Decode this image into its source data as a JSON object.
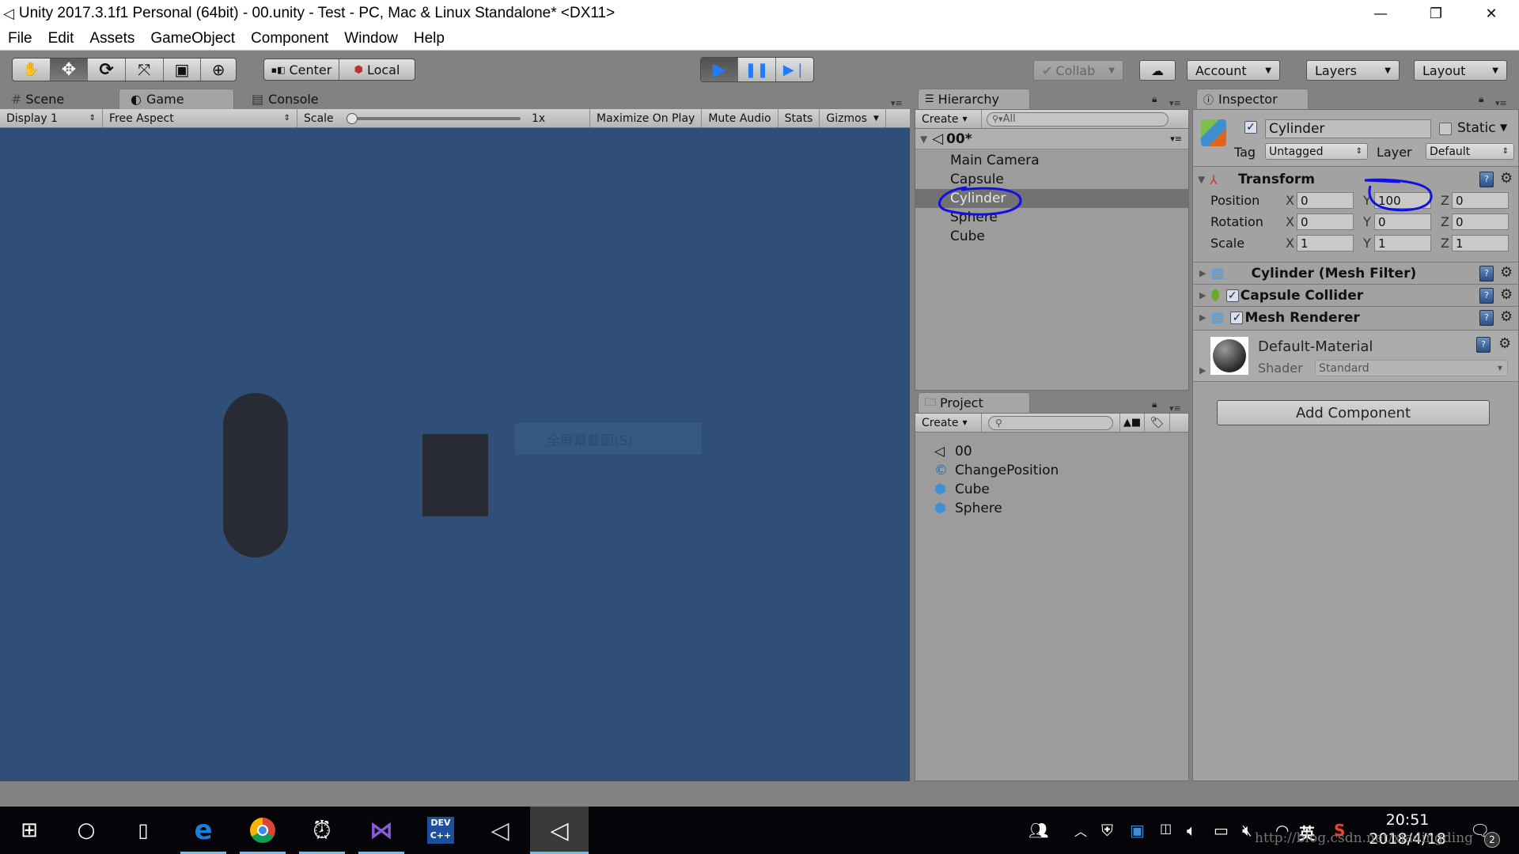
{
  "window": {
    "title": "Unity 2017.3.1f1 Personal (64bit) - 00.unity - Test - PC, Mac & Linux Standalone* <DX11>",
    "controls": {
      "minimize": "—",
      "restore": "❐",
      "close": "✕"
    }
  },
  "menu": [
    "File",
    "Edit",
    "Assets",
    "GameObject",
    "Component",
    "Window",
    "Help"
  ],
  "toolbar": {
    "tools": [
      {
        "name": "hand-tool",
        "glyph": "✋",
        "active": false
      },
      {
        "name": "move-tool",
        "glyph": "✥",
        "active": true
      },
      {
        "name": "rotate-tool",
        "glyph": "⟳",
        "active": false
      },
      {
        "name": "scale-tool",
        "glyph": "⤧",
        "active": false
      },
      {
        "name": "rect-tool",
        "glyph": "▣",
        "active": false
      },
      {
        "name": "transform-tool",
        "glyph": "⊕",
        "active": false
      }
    ],
    "pivot_mode": "Center",
    "pivot_rotation": "Local",
    "play": {
      "play_glyph": "▶",
      "pause_glyph": "❚❚",
      "step_glyph": "▶❘",
      "playing": true,
      "accent": "#1e7cff"
    },
    "collab": "Collab",
    "cloud_glyph": "☁",
    "account": "Account",
    "layers": "Layers",
    "layout": "Layout"
  },
  "game_panel": {
    "tabs": [
      {
        "label": "Scene",
        "glyph": "#",
        "active": false
      },
      {
        "label": "Game",
        "glyph": "◐",
        "active": true
      },
      {
        "label": "Console",
        "glyph": "▤",
        "active": false
      }
    ],
    "display": "Display 1",
    "aspect": "Free Aspect",
    "scale_label": "Scale",
    "scale_value": "1x",
    "scale_fraction": 0.0,
    "maximize_on_play": "Maximize On Play",
    "mute_audio": "Mute Audio",
    "stats": "Stats",
    "gizmos": "Gizmos",
    "background_color": "#2f4e78",
    "object_color": "#282b33",
    "overlay_tooltip": "全屏幕截图(S)"
  },
  "hierarchy": {
    "tab_label": "Hierarchy",
    "create_label": "Create",
    "search_placeholder": "All",
    "scene_name": "00*",
    "items": [
      {
        "label": "Main Camera",
        "selected": false
      },
      {
        "label": "Capsule",
        "selected": false
      },
      {
        "label": "Cylinder",
        "selected": true
      },
      {
        "label": "Sphere",
        "selected": false
      },
      {
        "label": "Cube",
        "selected": false
      }
    ]
  },
  "project": {
    "tab_label": "Project",
    "create_label": "Create",
    "search_placeholder": "",
    "items": [
      {
        "label": "00",
        "icon": "unity-scene-icon"
      },
      {
        "label": "ChangePosition",
        "icon": "csharp-script-icon"
      },
      {
        "label": "Cube",
        "icon": "prefab-icon"
      },
      {
        "label": "Sphere",
        "icon": "prefab-icon"
      }
    ]
  },
  "inspector": {
    "tab_label": "Inspector",
    "object_name": "Cylinder",
    "active": true,
    "static_label": "Static",
    "static": false,
    "tag_label": "Tag",
    "tag_value": "Untagged",
    "layer_label": "Layer",
    "layer_value": "Default",
    "transform": {
      "title": "Transform",
      "rows": [
        {
          "label": "Position",
          "x": "0",
          "y": "100",
          "z": "0"
        },
        {
          "label": "Rotation",
          "x": "0",
          "y": "0",
          "z": "0"
        },
        {
          "label": "Scale",
          "x": "1",
          "y": "1",
          "z": "1"
        }
      ],
      "axis": {
        "x": "X",
        "y": "Y",
        "z": "Z"
      }
    },
    "components": [
      {
        "title": "Cylinder (Mesh Filter)",
        "has_checkbox": false,
        "checked": false
      },
      {
        "title": "Capsule Collider",
        "has_checkbox": true,
        "checked": true
      },
      {
        "title": "Mesh Renderer",
        "has_checkbox": true,
        "checked": true
      }
    ],
    "material": {
      "name": "Default-Material",
      "shader_label": "Shader",
      "shader_value": "Standard"
    },
    "add_component": "Add Component"
  },
  "annotations": {
    "color": "#1010e0"
  },
  "taskbar": {
    "apps": [
      "start",
      "cortana",
      "task-view",
      "edge",
      "chrome",
      "alarm-clock",
      "visual-studio",
      "dev-cpp",
      "unity-hub",
      "unity-editor"
    ],
    "time": "20:51",
    "date": "2018/4/18",
    "ime": "英",
    "notifications": "2",
    "watermark": "http://blog.csdn.net/xiadingding"
  }
}
